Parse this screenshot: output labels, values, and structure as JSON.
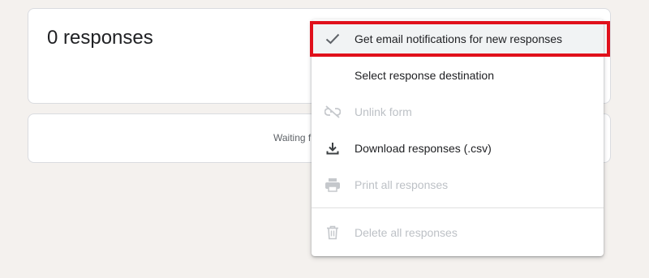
{
  "summary": {
    "title": "0 responses"
  },
  "waiting": {
    "text": "Waiting f"
  },
  "menu": {
    "items": [
      {
        "label": "Get email notifications for new responses",
        "icon": "check-icon",
        "disabled": false,
        "checked": true
      },
      {
        "label": "Select response destination",
        "icon": "",
        "disabled": false
      },
      {
        "label": "Unlink form",
        "icon": "link-off-icon",
        "disabled": true
      },
      {
        "label": "Download responses (.csv)",
        "icon": "download-icon",
        "disabled": false
      },
      {
        "label": "Print all responses",
        "icon": "print-icon",
        "disabled": true
      },
      {
        "label": "Delete all responses",
        "icon": "trash-icon",
        "disabled": true
      }
    ]
  },
  "colors": {
    "highlight_border": "#e0101b",
    "text_primary": "#202124",
    "text_disabled": "#bdc1c6",
    "background": "#f4f1ee"
  }
}
